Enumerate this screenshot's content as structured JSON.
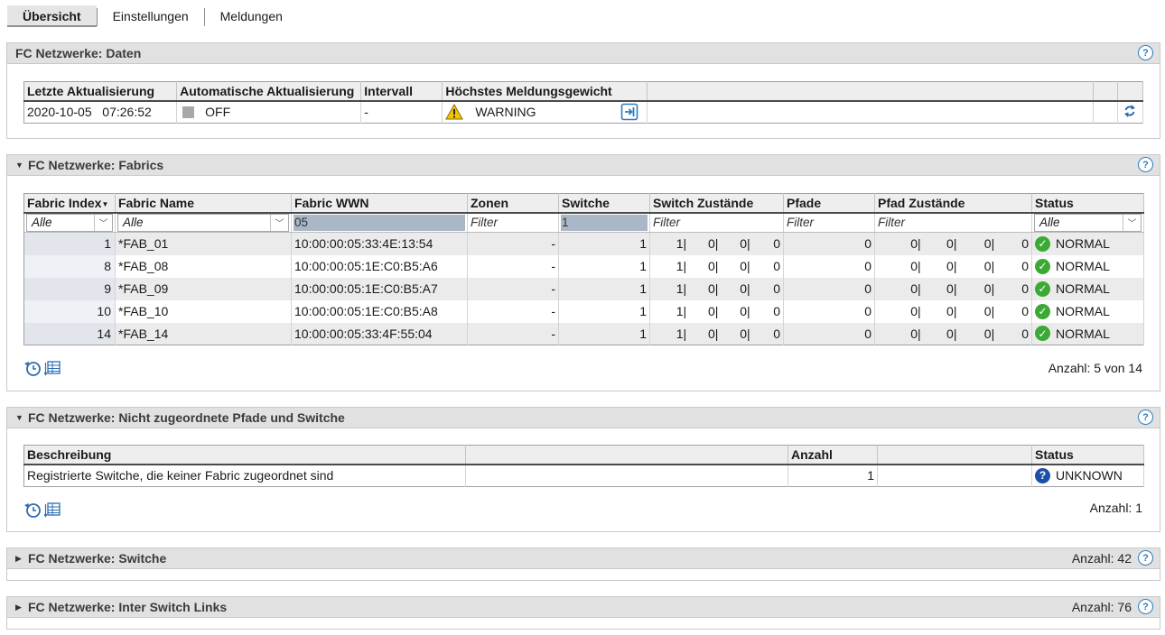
{
  "tabs": [
    {
      "label": "Übersicht",
      "active": true
    },
    {
      "label": "Einstellungen",
      "active": false
    },
    {
      "label": "Meldungen",
      "active": false
    }
  ],
  "panel_daten": {
    "title": "FC Netzwerke: Daten",
    "headers": [
      "Letzte Aktualisierung",
      "Automatische Aktualisierung",
      "Intervall",
      "Höchstes Meldungsgewicht"
    ],
    "row": {
      "date": "2020-10-05",
      "time": "07:26:52",
      "auto_update": "OFF",
      "interval": "-",
      "weight": "WARNING"
    }
  },
  "panel_fabrics": {
    "title": "FC Netzwerke: Fabrics",
    "headers": [
      "Fabric Index",
      "Fabric Name",
      "Fabric WWN",
      "Zonen",
      "Switche",
      "Switch Zustände",
      "Pfade",
      "Pfad Zustände",
      "Status"
    ],
    "filters": {
      "index": "Alle",
      "name": "Alle",
      "wwn": "05",
      "zonen": "Filter",
      "switche": "1",
      "switch_states": "Filter",
      "pfade": "Filter",
      "pfad_states": "Filter",
      "status": "Alle"
    },
    "rows": [
      {
        "index": "1",
        "name": "*FAB_01",
        "wwn": "10:00:00:05:33:4E:13:54",
        "zonen": "-",
        "switche": "1",
        "sw_states": [
          "1|",
          "0|",
          "0|",
          "0"
        ],
        "pfade": "0",
        "pf_states": [
          "0|",
          "0|",
          "0|",
          "0"
        ],
        "status": "NORMAL"
      },
      {
        "index": "8",
        "name": "*FAB_08",
        "wwn": "10:00:00:05:1E:C0:B5:A6",
        "zonen": "-",
        "switche": "1",
        "sw_states": [
          "1|",
          "0|",
          "0|",
          "0"
        ],
        "pfade": "0",
        "pf_states": [
          "0|",
          "0|",
          "0|",
          "0"
        ],
        "status": "NORMAL"
      },
      {
        "index": "9",
        "name": "*FAB_09",
        "wwn": "10:00:00:05:1E:C0:B5:A7",
        "zonen": "-",
        "switche": "1",
        "sw_states": [
          "1|",
          "0|",
          "0|",
          "0"
        ],
        "pfade": "0",
        "pf_states": [
          "0|",
          "0|",
          "0|",
          "0"
        ],
        "status": "NORMAL"
      },
      {
        "index": "10",
        "name": "*FAB_10",
        "wwn": "10:00:00:05:1E:C0:B5:A8",
        "zonen": "-",
        "switche": "1",
        "sw_states": [
          "1|",
          "0|",
          "0|",
          "0"
        ],
        "pfade": "0",
        "pf_states": [
          "0|",
          "0|",
          "0|",
          "0"
        ],
        "status": "NORMAL"
      },
      {
        "index": "14",
        "name": "*FAB_14",
        "wwn": "10:00:00:05:33:4F:55:04",
        "zonen": "-",
        "switche": "1",
        "sw_states": [
          "1|",
          "0|",
          "0|",
          "0"
        ],
        "pfade": "0",
        "pf_states": [
          "0|",
          "0|",
          "0|",
          "0"
        ],
        "status": "NORMAL"
      }
    ],
    "count": "Anzahl: 5 von 14"
  },
  "panel_unassigned": {
    "title": "FC Netzwerke: Nicht zugeordnete Pfade und Switche",
    "headers": [
      "Beschreibung",
      "Anzahl",
      "Status"
    ],
    "row": {
      "description": "Registrierte Switche, die keiner Fabric zugeordnet sind",
      "count": "1",
      "status": "UNKNOWN"
    },
    "count": "Anzahl: 1"
  },
  "panel_switches": {
    "title": "FC Netzwerke: Switche",
    "count": "Anzahl: 42"
  },
  "panel_isl": {
    "title": "FC Netzwerke: Inter Switch Links",
    "count": "Anzahl: 76"
  },
  "colors": {
    "ok": "#3aaa35",
    "unknown": "#1d4ea8",
    "warning": "#f5c400",
    "help": "#2b7ec1"
  },
  "icons": [
    "help-icon",
    "warning-icon",
    "export-icon",
    "refresh-icon",
    "check-circle-icon",
    "question-circle-icon",
    "history-icon",
    "column-settings-icon",
    "collapse-triangle-icon",
    "expand-triangle-icon",
    "sort-desc-icon",
    "dropdown-icon"
  ]
}
